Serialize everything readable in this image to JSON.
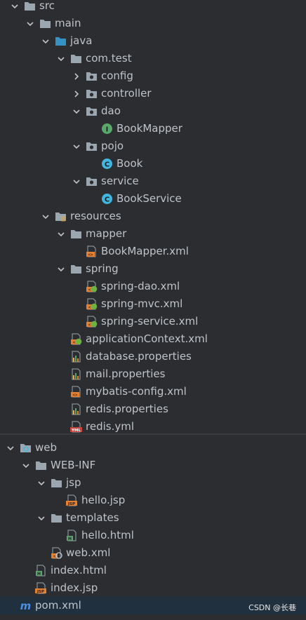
{
  "tree_top": [
    {
      "label": "src",
      "indent": 0,
      "arrow": "down",
      "icon": "folder"
    },
    {
      "label": "main",
      "indent": 1,
      "arrow": "down",
      "icon": "folder"
    },
    {
      "label": "java",
      "indent": 2,
      "arrow": "down",
      "icon": "folder-blue"
    },
    {
      "label": "com.test",
      "indent": 3,
      "arrow": "down",
      "icon": "folder"
    },
    {
      "label": "config",
      "indent": 4,
      "arrow": "right",
      "icon": "package"
    },
    {
      "label": "controller",
      "indent": 4,
      "arrow": "right",
      "icon": "package"
    },
    {
      "label": "dao",
      "indent": 4,
      "arrow": "down",
      "icon": "package"
    },
    {
      "label": "BookMapper",
      "indent": 5,
      "arrow": "none",
      "icon": "interface"
    },
    {
      "label": "pojo",
      "indent": 4,
      "arrow": "down",
      "icon": "package"
    },
    {
      "label": "Book",
      "indent": 5,
      "arrow": "none",
      "icon": "class"
    },
    {
      "label": "service",
      "indent": 4,
      "arrow": "down",
      "icon": "package"
    },
    {
      "label": "BookService",
      "indent": 5,
      "arrow": "none",
      "icon": "class"
    },
    {
      "label": "resources",
      "indent": 2,
      "arrow": "down",
      "icon": "resources-folder"
    },
    {
      "label": "mapper",
      "indent": 3,
      "arrow": "down",
      "icon": "folder"
    },
    {
      "label": "BookMapper.xml",
      "indent": 4,
      "arrow": "none",
      "icon": "xml"
    },
    {
      "label": "spring",
      "indent": 3,
      "arrow": "down",
      "icon": "folder"
    },
    {
      "label": "spring-dao.xml",
      "indent": 4,
      "arrow": "none",
      "icon": "spring-xml"
    },
    {
      "label": "spring-mvc.xml",
      "indent": 4,
      "arrow": "none",
      "icon": "spring-xml"
    },
    {
      "label": "spring-service.xml",
      "indent": 4,
      "arrow": "none",
      "icon": "spring-xml"
    },
    {
      "label": "applicationContext.xml",
      "indent": 3,
      "arrow": "none",
      "icon": "spring-xml"
    },
    {
      "label": "database.properties",
      "indent": 3,
      "arrow": "none",
      "icon": "properties"
    },
    {
      "label": "mail.properties",
      "indent": 3,
      "arrow": "none",
      "icon": "properties"
    },
    {
      "label": "mybatis-config.xml",
      "indent": 3,
      "arrow": "none",
      "icon": "xml"
    },
    {
      "label": "redis.properties",
      "indent": 3,
      "arrow": "none",
      "icon": "properties"
    },
    {
      "label": "redis.yml",
      "indent": 3,
      "arrow": "none",
      "icon": "yml"
    }
  ],
  "tree_bottom": [
    {
      "label": "web",
      "indent": 0,
      "arrow": "down",
      "icon": "web-folder"
    },
    {
      "label": "WEB-INF",
      "indent": 1,
      "arrow": "down",
      "icon": "folder"
    },
    {
      "label": "jsp",
      "indent": 2,
      "arrow": "down",
      "icon": "folder"
    },
    {
      "label": "hello.jsp",
      "indent": 3,
      "arrow": "none",
      "icon": "jsp"
    },
    {
      "label": "templates",
      "indent": 2,
      "arrow": "down",
      "icon": "folder"
    },
    {
      "label": "hello.html",
      "indent": 3,
      "arrow": "none",
      "icon": "html"
    },
    {
      "label": "web.xml",
      "indent": 2,
      "arrow": "none",
      "icon": "webxml"
    },
    {
      "label": "index.html",
      "indent": 1,
      "arrow": "none",
      "icon": "html"
    },
    {
      "label": "index.jsp",
      "indent": 1,
      "arrow": "none",
      "icon": "jsp"
    },
    {
      "label": "pom.xml",
      "indent": 0,
      "arrow": "none",
      "icon": "maven"
    }
  ],
  "watermark": "CSDN @长巷",
  "colors": {
    "background": "#2b2d30",
    "text": "#bfc4cb",
    "selection": "#20303f",
    "folder": "#9aa7b0",
    "folder_blue": "#3592c4",
    "interface_green": "#59a869",
    "class_blue": "#40b6e0",
    "xml_orange": "#e67f2e",
    "spring_green": "#6db33f"
  }
}
